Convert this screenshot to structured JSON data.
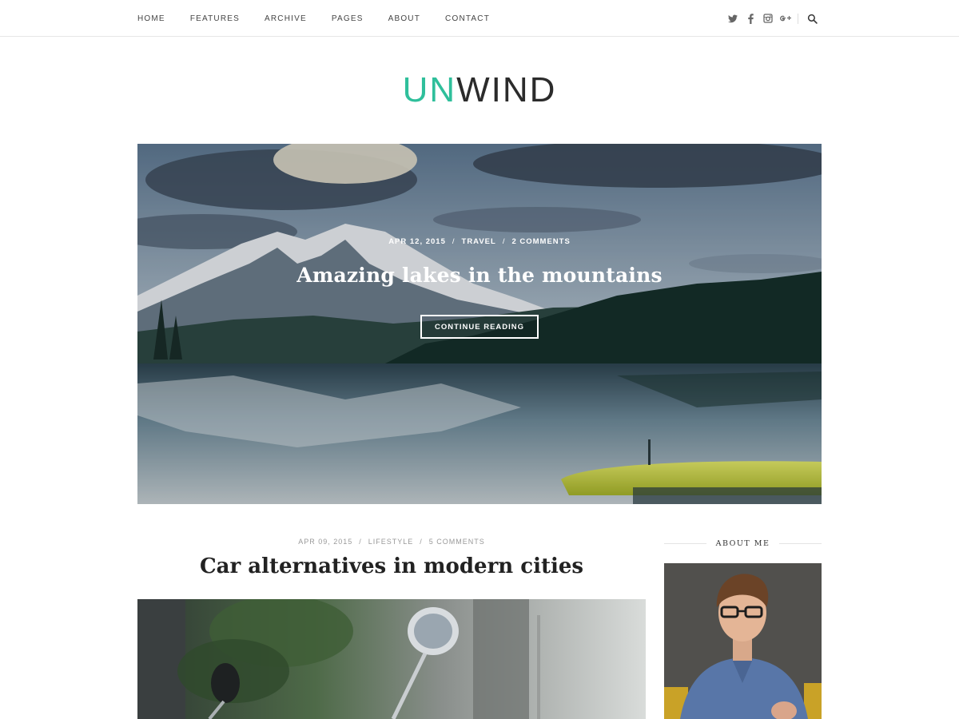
{
  "nav": {
    "items": [
      "HOME",
      "FEATURES",
      "ARCHIVE",
      "PAGES",
      "ABOUT",
      "CONTACT"
    ]
  },
  "social": {
    "icons": [
      "twitter-icon",
      "facebook-icon",
      "instagram-icon",
      "google-plus-icon",
      "search-icon"
    ]
  },
  "logo": {
    "part1": "UN",
    "part2": "WIND",
    "accent_color": "#2fbf9b"
  },
  "hero": {
    "date": "APR 12, 2015",
    "category": "TRAVEL",
    "comments": "2 COMMENTS",
    "separator": "/",
    "title": "Amazing lakes in the mountains",
    "button": "CONTINUE READING"
  },
  "post": {
    "date": "APR 09, 2015",
    "category": "LIFESTYLE",
    "comments": "5 COMMENTS",
    "separator": "/",
    "title": "Car alternatives in modern cities"
  },
  "sidebar": {
    "about_title": "ABOUT ME"
  }
}
